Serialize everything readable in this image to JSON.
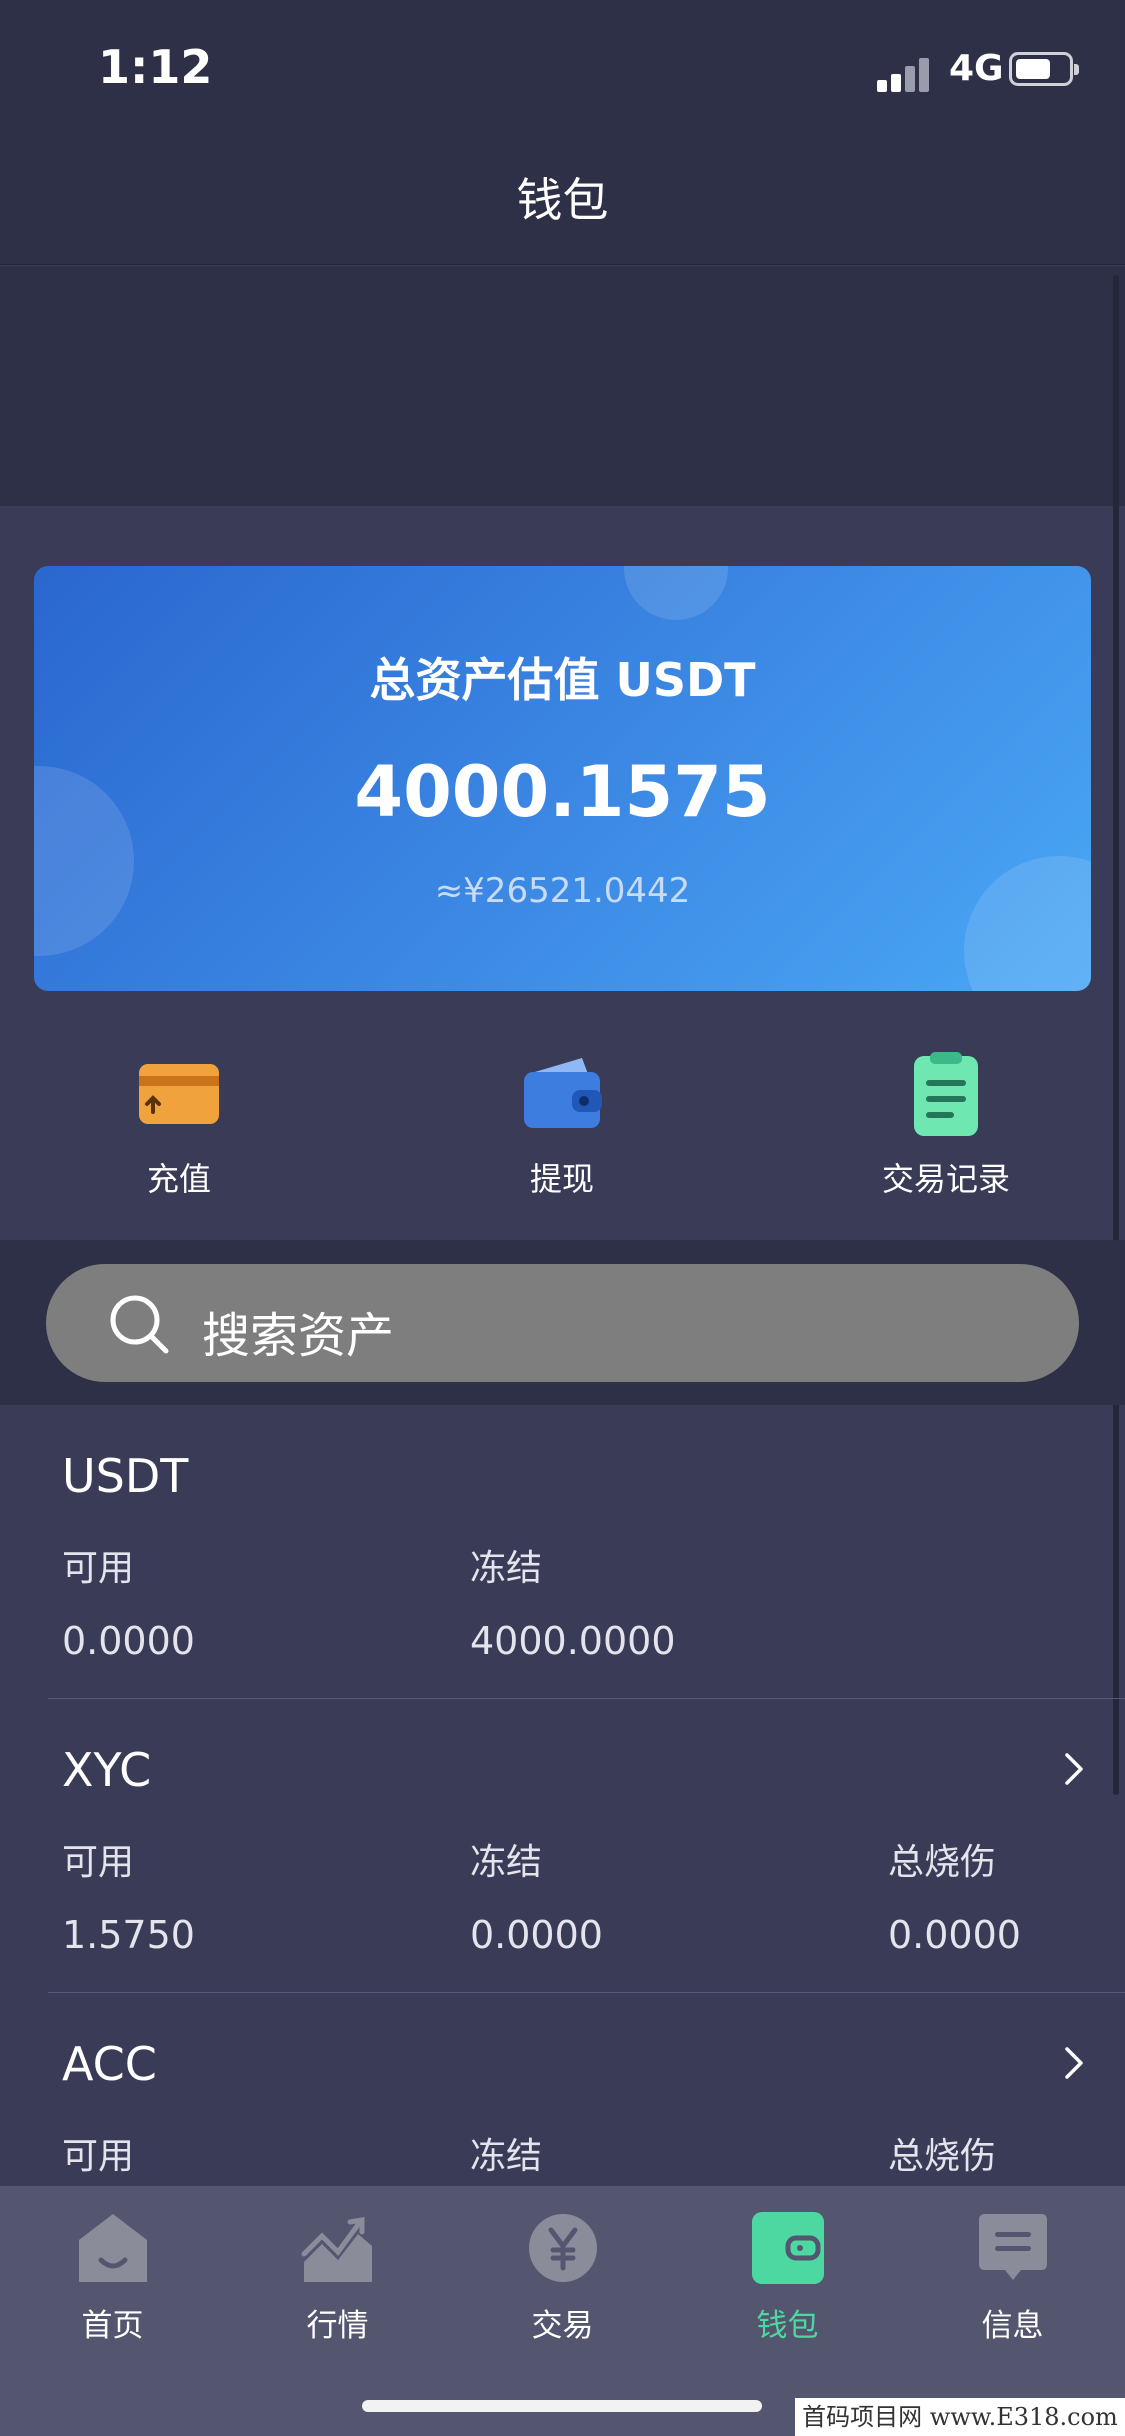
{
  "status_bar": {
    "time": "1:12",
    "network": "4G"
  },
  "header": {
    "title": "钱包"
  },
  "asset_card": {
    "label": "总资产估值 USDT",
    "amount": "4000.1575",
    "cny_estimate": "≈¥26521.0442"
  },
  "actions": [
    {
      "label": "充值",
      "icon": "deposit-card-icon",
      "color": "#f0a23c"
    },
    {
      "label": "提现",
      "icon": "wallet-icon",
      "color": "#3d7de0"
    },
    {
      "label": "交易记录",
      "icon": "clipboard-icon",
      "color": "#6ee7b0"
    }
  ],
  "search": {
    "placeholder": "搜索资产"
  },
  "assets": [
    {
      "name": "USDT",
      "available_label": "可用",
      "available": "0.0000",
      "frozen_label": "冻结",
      "frozen": "4000.0000"
    },
    {
      "name": "XYC",
      "available_label": "可用",
      "available": "1.5750",
      "frozen_label": "冻结",
      "frozen": "0.0000",
      "burn_label": "总烧伤",
      "burn": "0.0000"
    },
    {
      "name": "ACC",
      "available_label": "可用",
      "frozen_label": "冻结",
      "burn_label": "总烧伤"
    }
  ],
  "tabs": [
    {
      "label": "首页",
      "icon": "home-icon",
      "active": false
    },
    {
      "label": "行情",
      "icon": "chart-icon",
      "active": false
    },
    {
      "label": "交易",
      "icon": "yen-coin-icon",
      "active": false
    },
    {
      "label": "钱包",
      "icon": "wallet-icon",
      "active": true
    },
    {
      "label": "信息",
      "icon": "message-icon",
      "active": false
    }
  ],
  "colors": {
    "accent_green": "#4cd8a0",
    "background": "#3a3c57",
    "card_blue": "#3b86e3"
  },
  "watermark": "首码项目网 www.E318.com"
}
